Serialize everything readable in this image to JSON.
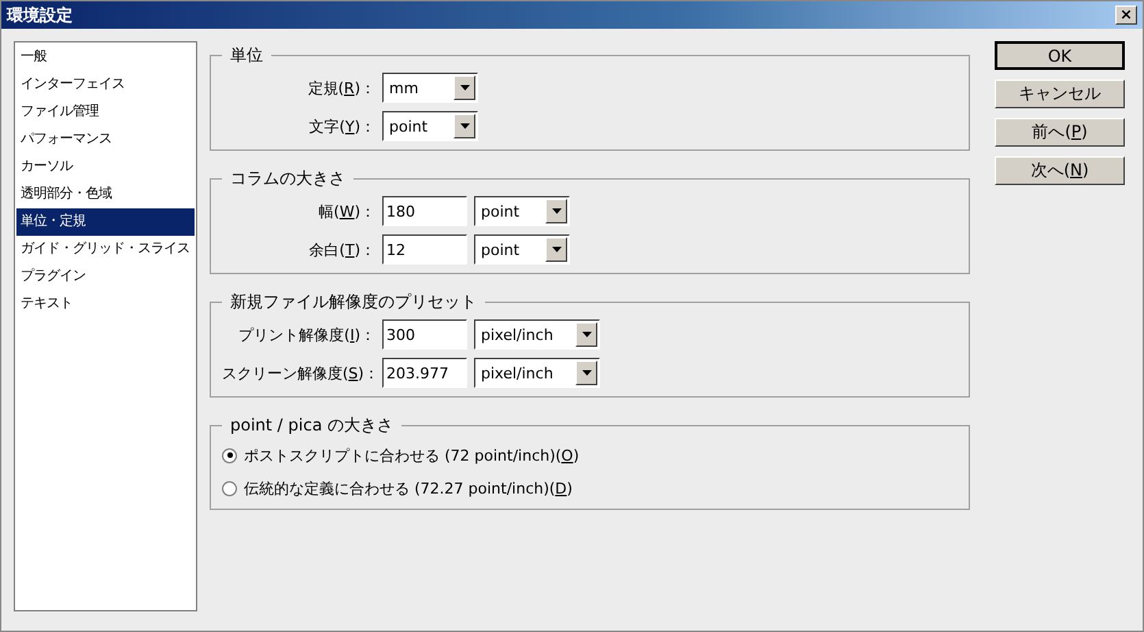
{
  "window": {
    "title": "環境設定",
    "close": "×"
  },
  "sidebar": {
    "items": [
      {
        "label": "一般",
        "selected": false
      },
      {
        "label": "インターフェイス",
        "selected": false
      },
      {
        "label": "ファイル管理",
        "selected": false
      },
      {
        "label": "パフォーマンス",
        "selected": false
      },
      {
        "label": "カーソル",
        "selected": false
      },
      {
        "label": "透明部分・色域",
        "selected": false
      },
      {
        "label": "単位・定規",
        "selected": true
      },
      {
        "label": "ガイド・グリッド・スライス",
        "selected": false
      },
      {
        "label": "プラグイン",
        "selected": false
      },
      {
        "label": "テキスト",
        "selected": false
      }
    ]
  },
  "groups": [
    {
      "title": "単位",
      "rows": [
        {
          "label": {
            "before": "定規(",
            "key": "R",
            "after": ")："
          },
          "input": null,
          "select": {
            "value": "mm"
          }
        },
        {
          "label": {
            "before": "文字(",
            "key": "Y",
            "after": ")："
          },
          "input": null,
          "select": {
            "value": "point"
          }
        }
      ]
    },
    {
      "title": "コラムの大きさ",
      "rows": [
        {
          "label": {
            "before": "幅(",
            "key": "W",
            "after": ")："
          },
          "input": "180",
          "select": {
            "value": "point"
          }
        },
        {
          "label": {
            "before": "余白(",
            "key": "T",
            "after": ")："
          },
          "input": "12",
          "select": {
            "value": "point"
          }
        }
      ]
    },
    {
      "title": "新規ファイル解像度のプリセット",
      "rows": [
        {
          "label": {
            "before": "プリント解像度(",
            "key": "I",
            "after": ")："
          },
          "input": "300",
          "select": {
            "value": "pixel/inch"
          }
        },
        {
          "label": {
            "before": "スクリーン解像度(",
            "key": "S",
            "after": ")："
          },
          "input": "203.977",
          "select": {
            "value": "pixel/inch"
          }
        }
      ]
    }
  ],
  "point_pica": {
    "title": "point / pica の大きさ",
    "options": [
      {
        "before": "ポストスクリプトに合わせる (72 point/inch)(",
        "key": "O",
        "after": ")",
        "selected": true
      },
      {
        "before": "伝統的な定義に合わせる (72.27 point/inch)(",
        "key": "D",
        "after": ")",
        "selected": false
      }
    ]
  },
  "buttons": [
    {
      "label": {
        "before": "OK"
      },
      "default": true
    },
    {
      "label": {
        "before": "キャンセル"
      },
      "default": false
    },
    {
      "label": {
        "before": "前へ(",
        "key": "P",
        "after": ")"
      },
      "default": false
    },
    {
      "label": {
        "before": "次へ(",
        "key": "N",
        "after": ")"
      },
      "default": false
    }
  ]
}
